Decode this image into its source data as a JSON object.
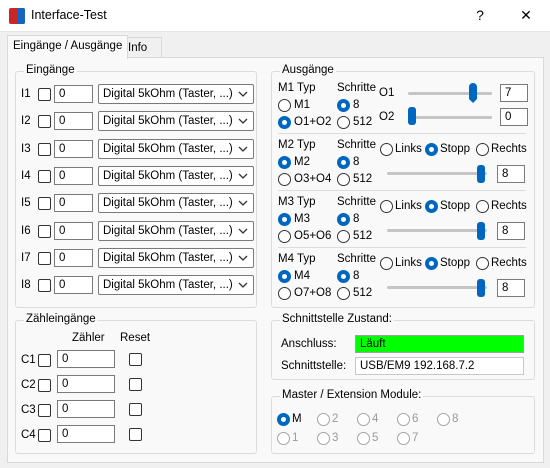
{
  "window": {
    "title": "Interface-Test",
    "help_label": "?",
    "close_label": "✕"
  },
  "tabs": [
    {
      "label": "Eingänge / Ausgänge"
    },
    {
      "label": "Info"
    }
  ],
  "inputs": {
    "title": "Eingänge",
    "rows": [
      {
        "label": "I1",
        "value": "0",
        "mode": "Digital 5kOhm (Taster, ...)"
      },
      {
        "label": "I2",
        "value": "0",
        "mode": "Digital 5kOhm (Taster, ...)"
      },
      {
        "label": "I3",
        "value": "0",
        "mode": "Digital 5kOhm (Taster, ...)"
      },
      {
        "label": "I4",
        "value": "0",
        "mode": "Digital 5kOhm (Taster, ...)"
      },
      {
        "label": "I5",
        "value": "0",
        "mode": "Digital 5kOhm (Taster, ...)"
      },
      {
        "label": "I6",
        "value": "0",
        "mode": "Digital 5kOhm (Taster, ...)"
      },
      {
        "label": "I7",
        "value": "0",
        "mode": "Digital 5kOhm (Taster, ...)"
      },
      {
        "label": "I8",
        "value": "0",
        "mode": "Digital 5kOhm (Taster, ...)"
      }
    ]
  },
  "counters": {
    "title": "Zähleingänge",
    "col_counter": "Zähler",
    "col_reset": "Reset",
    "rows": [
      {
        "label": "C1",
        "value": "0"
      },
      {
        "label": "C2",
        "value": "0"
      },
      {
        "label": "C3",
        "value": "0"
      },
      {
        "label": "C4",
        "value": "0"
      }
    ]
  },
  "outputs": {
    "title": "Ausgänge",
    "motors": [
      {
        "type_label": "M1 Typ",
        "steps_label": "Schritte",
        "opt_a": "M1",
        "opt_b": "O1+O2",
        "selected_type": "b",
        "steps_a": "8",
        "steps_b": "512",
        "selected_steps": "a",
        "outputs": [
          {
            "label": "O1",
            "value": "7",
            "level": 7,
            "max": 8
          },
          {
            "label": "O2",
            "value": "0",
            "level": 0,
            "max": 8
          }
        ]
      },
      {
        "type_label": "M2 Typ",
        "steps_label": "Schritte",
        "opt_a": "M2",
        "opt_b": "O3+O4",
        "selected_type": "a",
        "steps_a": "8",
        "steps_b": "512",
        "selected_steps": "a",
        "dir": {
          "left": "Links",
          "stop": "Stopp",
          "right": "Rechts",
          "selected": "stop"
        },
        "speed": {
          "value": "8",
          "level": 8,
          "max": 8
        }
      },
      {
        "type_label": "M3 Typ",
        "steps_label": "Schritte",
        "opt_a": "M3",
        "opt_b": "O5+O6",
        "selected_type": "a",
        "steps_a": "8",
        "steps_b": "512",
        "selected_steps": "a",
        "dir": {
          "left": "Links",
          "stop": "Stopp",
          "right": "Rechts",
          "selected": "stop"
        },
        "speed": {
          "value": "8",
          "level": 8,
          "max": 8
        }
      },
      {
        "type_label": "M4 Typ",
        "steps_label": "Schritte",
        "opt_a": "M4",
        "opt_b": "O7+O8",
        "selected_type": "a",
        "steps_a": "8",
        "steps_b": "512",
        "selected_steps": "a",
        "dir": {
          "left": "Links",
          "stop": "Stopp",
          "right": "Rechts",
          "selected": "stop"
        },
        "speed": {
          "value": "8",
          "level": 8,
          "max": 8
        }
      }
    ]
  },
  "interface": {
    "title": "Schnittstelle Zustand:",
    "conn_label": "Anschluss:",
    "conn_value": "Läuft",
    "conn_color": "#00ff00",
    "port_label": "Schnittstelle:",
    "port_value": "USB/EM9 192.168.7.2"
  },
  "master": {
    "title": "Master / Extension Module:",
    "options": [
      "M",
      "2",
      "4",
      "6",
      "8",
      "1",
      "3",
      "5",
      "7"
    ],
    "selected": "M"
  },
  "colors": {
    "accent": "#0067c0",
    "status_ok": "#00ff00"
  }
}
